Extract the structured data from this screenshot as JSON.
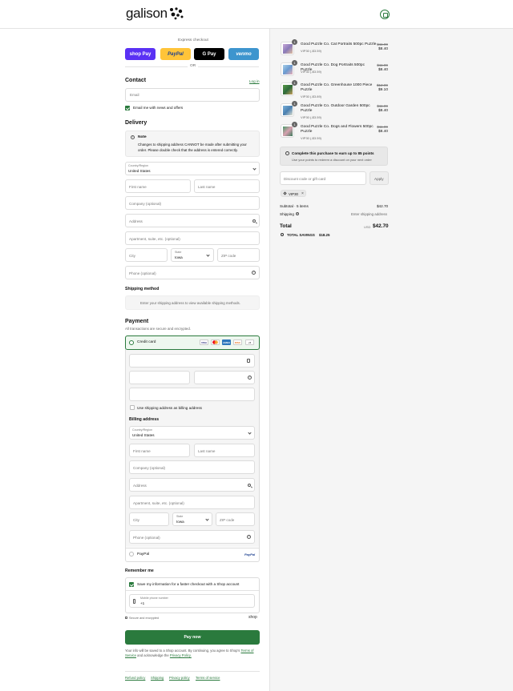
{
  "brand": {
    "name": "galison"
  },
  "express": {
    "title": "Express checkout",
    "shop_pay": "shop Pay",
    "paypal": "PayPal",
    "gpay": "G Pay",
    "venmo": "venmo",
    "or": "OR"
  },
  "contact": {
    "heading": "Contact",
    "login": "Log in",
    "email_placeholder": "Email",
    "news_label": "Email me with news and offers"
  },
  "delivery": {
    "heading": "Delivery",
    "note_title": "Note",
    "note_text": "Changes to shipping address CANNOT be made after submitting your order. Please double check that the address is entered correctly.",
    "country_label": "Country/Region",
    "country_value": "United States",
    "first_name": "First name",
    "last_name": "Last name",
    "company": "Company (optional)",
    "address": "Address",
    "apartment": "Apartment, suite, etc. (optional)",
    "city": "City",
    "state_label": "State",
    "state_value": "Iowa",
    "zip": "ZIP code",
    "phone": "Phone (optional)"
  },
  "shipping": {
    "heading": "Shipping method",
    "message": "Enter your shipping address to view available shipping methods."
  },
  "payment": {
    "heading": "Payment",
    "subtitle": "All transactions are secure and encrypted.",
    "credit_card": "Credit card",
    "cards": [
      "VISA",
      "MC",
      "AMEX",
      "DISC",
      "+5"
    ],
    "use_shipping": "Use shipping address as billing address",
    "paypal": "PayPal",
    "paypal_logo": "PayPal"
  },
  "billing": {
    "heading": "Billing address",
    "country_label": "Country/Region",
    "country_value": "United States",
    "first_name": "First name",
    "last_name": "Last name",
    "company": "Company (optional)",
    "address": "Address",
    "apartment": "Apartment, suite, etc. (optional)",
    "city": "City",
    "state_label": "State",
    "state_value": "Iowa",
    "zip": "ZIP code",
    "phone": "Phone (optional)"
  },
  "remember": {
    "heading": "Remember me",
    "save_label": "Save my information for a faster checkout with a Shop account",
    "mobile_label": "Mobile phone number",
    "mobile_prefix": "+1",
    "secure": "Secure and encrypted",
    "shop": "shop"
  },
  "pay_now": "Pay now",
  "legal": {
    "text1": "Your info will be saved to a Shop account. By continuing, you agree to Shop's",
    "terms": "Terms of Service",
    "text2": "and acknowledge the",
    "privacy": "Privacy Policy."
  },
  "footer_links": [
    "Refund policy",
    "Shipping",
    "Privacy policy",
    "Terms of service"
  ],
  "cart": {
    "items": [
      {
        "qty": "1",
        "name": "Good Puzzle Co. Cat Portraits 500pc Puzzle",
        "tag": "VIP30 (-$3.59)",
        "old": "$11.99",
        "new": "$8.40"
      },
      {
        "qty": "1",
        "name": "Good Puzzle Co. Dog Portraits 500pc Puzzle",
        "tag": "VIP30 (-$3.59)",
        "old": "$11.99",
        "new": "$8.40"
      },
      {
        "qty": "1",
        "name": "Good Puzzle Co. Greenhouse 1000 Piece Puzzle",
        "tag": "VIP30 (-$3.89)",
        "old": "$12.99",
        "new": "$9.10"
      },
      {
        "qty": "1",
        "name": "Good Puzzle Co. Outdoor Garden 500pc Puzzle",
        "tag": "VIP30 (-$3.59)",
        "old": "$11.99",
        "new": "$8.40"
      },
      {
        "qty": "1",
        "name": "Good Puzzle Co. Dogs and Flowers 500pc Puzzle",
        "tag": "VIP30 (-$3.59)",
        "old": "$11.99",
        "new": "$8.40"
      }
    ],
    "points_title": "Complete this purchase to earn up to 85 points",
    "points_sub": "Use your points to redeem a discount on your next order",
    "discount_placeholder": "Discount code or gift card",
    "apply": "Apply",
    "code": "VIP30",
    "subtotal_label": "Subtotal · 5 items",
    "subtotal_value": "$42.70",
    "shipping_label": "Shipping",
    "shipping_value": "Enter shipping address",
    "total_label": "Total",
    "currency": "USD",
    "total_value": "$42.70",
    "savings_label": "TOTAL SAVINGS",
    "savings_value": "$18.25"
  }
}
